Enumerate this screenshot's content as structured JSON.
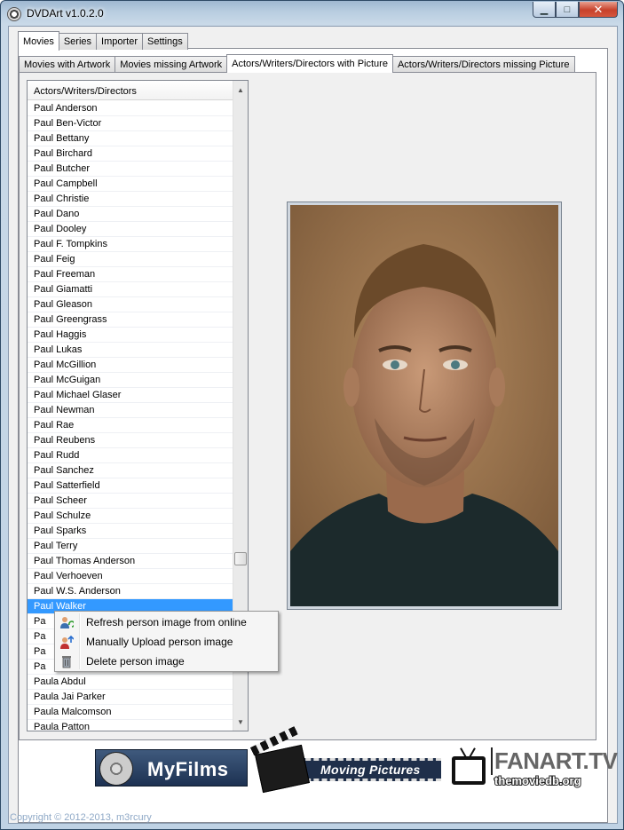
{
  "window": {
    "title": "DVDArt v1.0.2.0",
    "buttons": {
      "minimize": "▁",
      "maximize": "□",
      "close": "✕"
    }
  },
  "main_tabs": [
    "Movies",
    "Series",
    "Importer",
    "Settings"
  ],
  "sub_tabs": [
    "Movies with Artwork",
    "Movies missing Artwork",
    "Actors/Writers/Directors with Picture",
    "Actors/Writers/Directors missing Picture"
  ],
  "list": {
    "header": "Actors/Writers/Directors",
    "items": [
      "Paul Anderson",
      "Paul Ben-Victor",
      "Paul Bettany",
      "Paul Birchard",
      "Paul Butcher",
      "Paul Campbell",
      "Paul Christie",
      "Paul Dano",
      "Paul Dooley",
      "Paul F. Tompkins",
      "Paul Feig",
      "Paul Freeman",
      "Paul Giamatti",
      "Paul Gleason",
      "Paul Greengrass",
      "Paul Haggis",
      "Paul Lukas",
      "Paul McGillion",
      "Paul McGuigan",
      "Paul Michael Glaser",
      "Paul Newman",
      "Paul Rae",
      "Paul Reubens",
      "Paul Rudd",
      "Paul Sanchez",
      "Paul Satterfield",
      "Paul Scheer",
      "Paul Schulze",
      "Paul Sparks",
      "Paul Terry",
      "Paul Thomas Anderson",
      "Paul Verhoeven",
      "Paul W.S. Anderson",
      "Paul Walker",
      "Pa",
      "Pa",
      "Pa",
      "Pa",
      "Paula Abdul",
      "Paula Jai Parker",
      "Paula Malcomson",
      "Paula Patton"
    ],
    "selected": "Paul Walker"
  },
  "context_menu": {
    "items": [
      {
        "label": "Refresh person image from online",
        "icon": "person-refresh-icon"
      },
      {
        "label": "Manually Upload person image",
        "icon": "person-upload-icon"
      },
      {
        "label": "Delete person image",
        "icon": "trash-icon"
      }
    ]
  },
  "logos": {
    "myfilms": "MyFilms",
    "moving_pictures": "Moving Pictures",
    "fanart": "FANART.TV",
    "tmdb": "themoviedb.org"
  },
  "footer": {
    "copyright": "Copyright © 2012-2013, m3rcury"
  },
  "colors": {
    "selection": "#3399ff",
    "photo_bg": "#a0784e"
  }
}
